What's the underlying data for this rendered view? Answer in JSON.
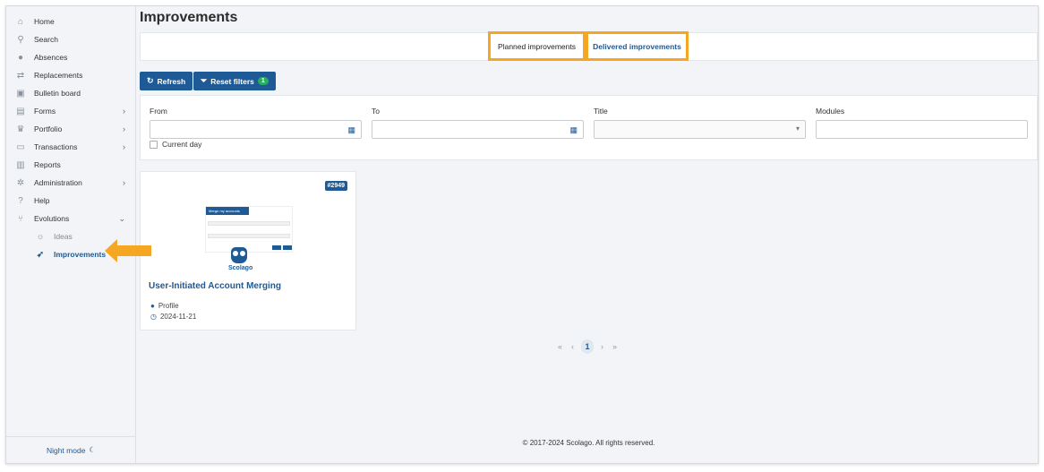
{
  "sidebar": {
    "items": [
      {
        "label": "Home",
        "icon": "home-icon",
        "chev": ""
      },
      {
        "label": "Search",
        "icon": "search-icon",
        "chev": ""
      },
      {
        "label": "Absences",
        "icon": "absences-icon",
        "chev": ""
      },
      {
        "label": "Replacements",
        "icon": "replacements-icon",
        "chev": ""
      },
      {
        "label": "Bulletin board",
        "icon": "bulletin-icon",
        "chev": ""
      },
      {
        "label": "Forms",
        "icon": "forms-icon",
        "chev": "›"
      },
      {
        "label": "Portfolio",
        "icon": "trophy-icon",
        "chev": "›"
      },
      {
        "label": "Transactions",
        "icon": "transactions-icon",
        "chev": "›"
      },
      {
        "label": "Reports",
        "icon": "reports-icon",
        "chev": ""
      },
      {
        "label": "Administration",
        "icon": "gear-icon",
        "chev": "›"
      },
      {
        "label": "Help",
        "icon": "help-icon",
        "chev": ""
      },
      {
        "label": "Evolutions",
        "icon": "evolutions-icon",
        "chev": "⌄"
      }
    ],
    "sub_items": [
      {
        "label": "Ideas",
        "icon": "bulb-icon"
      },
      {
        "label": "Improvements",
        "icon": "rocket-icon"
      }
    ],
    "night_mode": "Night mode"
  },
  "main": {
    "title": "Improvements",
    "tabs": [
      "Planned improvements",
      "Delivered improvements"
    ],
    "refresh_label": "Refresh",
    "reset_label": "Reset filters",
    "reset_badge": "1",
    "filters": {
      "from_label": "From",
      "to_label": "To",
      "title_label": "Title",
      "modules_label": "Modules",
      "current_day_label": "Current day"
    },
    "card": {
      "id": "#2949",
      "thumb_title": "Merge my accounts",
      "brand": "Scolago",
      "title": "User-Initiated Account Merging",
      "module": "Profile",
      "date": "2024-11-21"
    },
    "pager": {
      "first": "«",
      "prev": "‹",
      "current": "1",
      "next": "›",
      "last": "»"
    },
    "footer": "© 2017-2024 Scolago. All rights reserved."
  },
  "colors": {
    "accent": "#1e5a96",
    "highlight": "#f5a623",
    "badge_green": "#27ae60"
  }
}
